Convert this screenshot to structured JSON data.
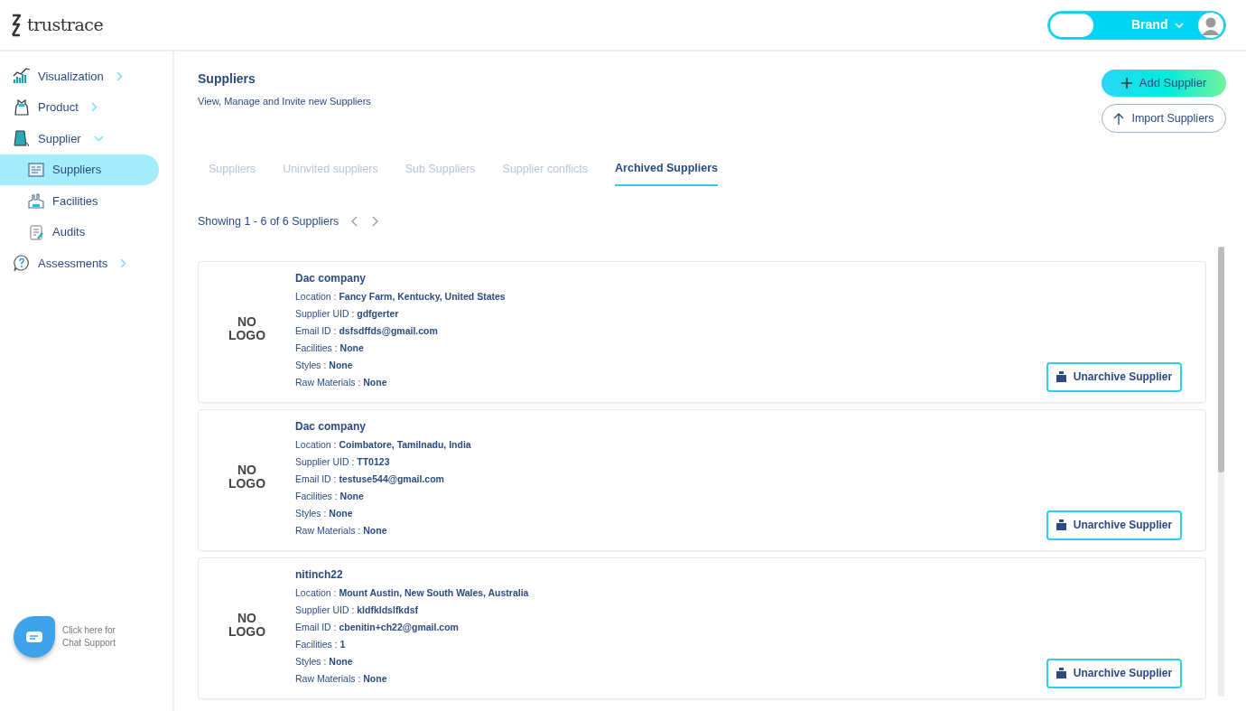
{
  "header": {
    "logo": "trustrace",
    "role_switch": {
      "label": "Brand",
      "on": false
    }
  },
  "sidebar": {
    "items": [
      {
        "label": "Visualization",
        "expanded": false
      },
      {
        "label": "Product",
        "expanded": false
      },
      {
        "label": "Supplier",
        "expanded": true,
        "children": [
          {
            "label": "Suppliers",
            "selected": true
          },
          {
            "label": "Facilities",
            "selected": false
          },
          {
            "label": "Audits",
            "selected": false
          }
        ]
      },
      {
        "label": "Assessments",
        "expanded": false
      }
    ],
    "chat": {
      "text": "Click here for Chat Support"
    }
  },
  "page": {
    "title": "Suppliers",
    "subtitle": "View, Manage and Invite new Suppliers",
    "buttons": [
      {
        "label": "Add Supplier",
        "kind": "primary"
      },
      {
        "label": "Import Suppliers",
        "kind": "outline"
      }
    ]
  },
  "tabs": [
    {
      "label": "Suppliers",
      "selected": false
    },
    {
      "label": "Uninvited suppliers",
      "selected": false
    },
    {
      "label": "Sub Suppliers",
      "selected": false
    },
    {
      "label": "Supplier conflicts",
      "selected": false
    },
    {
      "label": "Archived Suppliers",
      "selected": true
    }
  ],
  "pagination": {
    "text": "Showing 1 - 6 of 6 Suppliers"
  },
  "suppliers": [
    {
      "logo": "NO LOGO",
      "name": "Dac company",
      "fields": [
        {
          "label": "Location : ",
          "value": "Fancy Farm, Kentucky, United States"
        },
        {
          "label": "Supplier UID : ",
          "value": "gdfgerter"
        },
        {
          "label": "Email ID : ",
          "value": "dsfsdffds@gmail.com"
        },
        {
          "label": "Facilities : ",
          "value": "None"
        },
        {
          "label": "Styles : ",
          "value": "None"
        },
        {
          "label": "Raw Materials : ",
          "value": "None"
        }
      ],
      "action": "Unarchive Supplier"
    },
    {
      "logo": "NO LOGO",
      "name": "Dac company",
      "fields": [
        {
          "label": "Location : ",
          "value": "Coimbatore, Tamilnadu, India"
        },
        {
          "label": "Supplier UID : ",
          "value": "TT0123"
        },
        {
          "label": "Email ID : ",
          "value": "testuse544@gmail.com"
        },
        {
          "label": "Facilities : ",
          "value": "None"
        },
        {
          "label": "Styles : ",
          "value": "None"
        },
        {
          "label": "Raw Materials : ",
          "value": "None"
        }
      ],
      "action": "Unarchive Supplier"
    },
    {
      "logo": "NO LOGO",
      "name": "nitinch22",
      "fields": [
        {
          "label": "Location : ",
          "value": "Mount Austin, New South Wales, Australia"
        },
        {
          "label": "Supplier UID : ",
          "value": "kldfkldslfkdsf"
        },
        {
          "label": "Email ID : ",
          "value": "cbenitin+ch22@gmail.com"
        },
        {
          "label": "Facilities : ",
          "value": "1"
        },
        {
          "label": "Styles : ",
          "value": "None"
        },
        {
          "label": "Raw Materials : ",
          "value": "None"
        }
      ],
      "action": "Unarchive Supplier"
    }
  ]
}
